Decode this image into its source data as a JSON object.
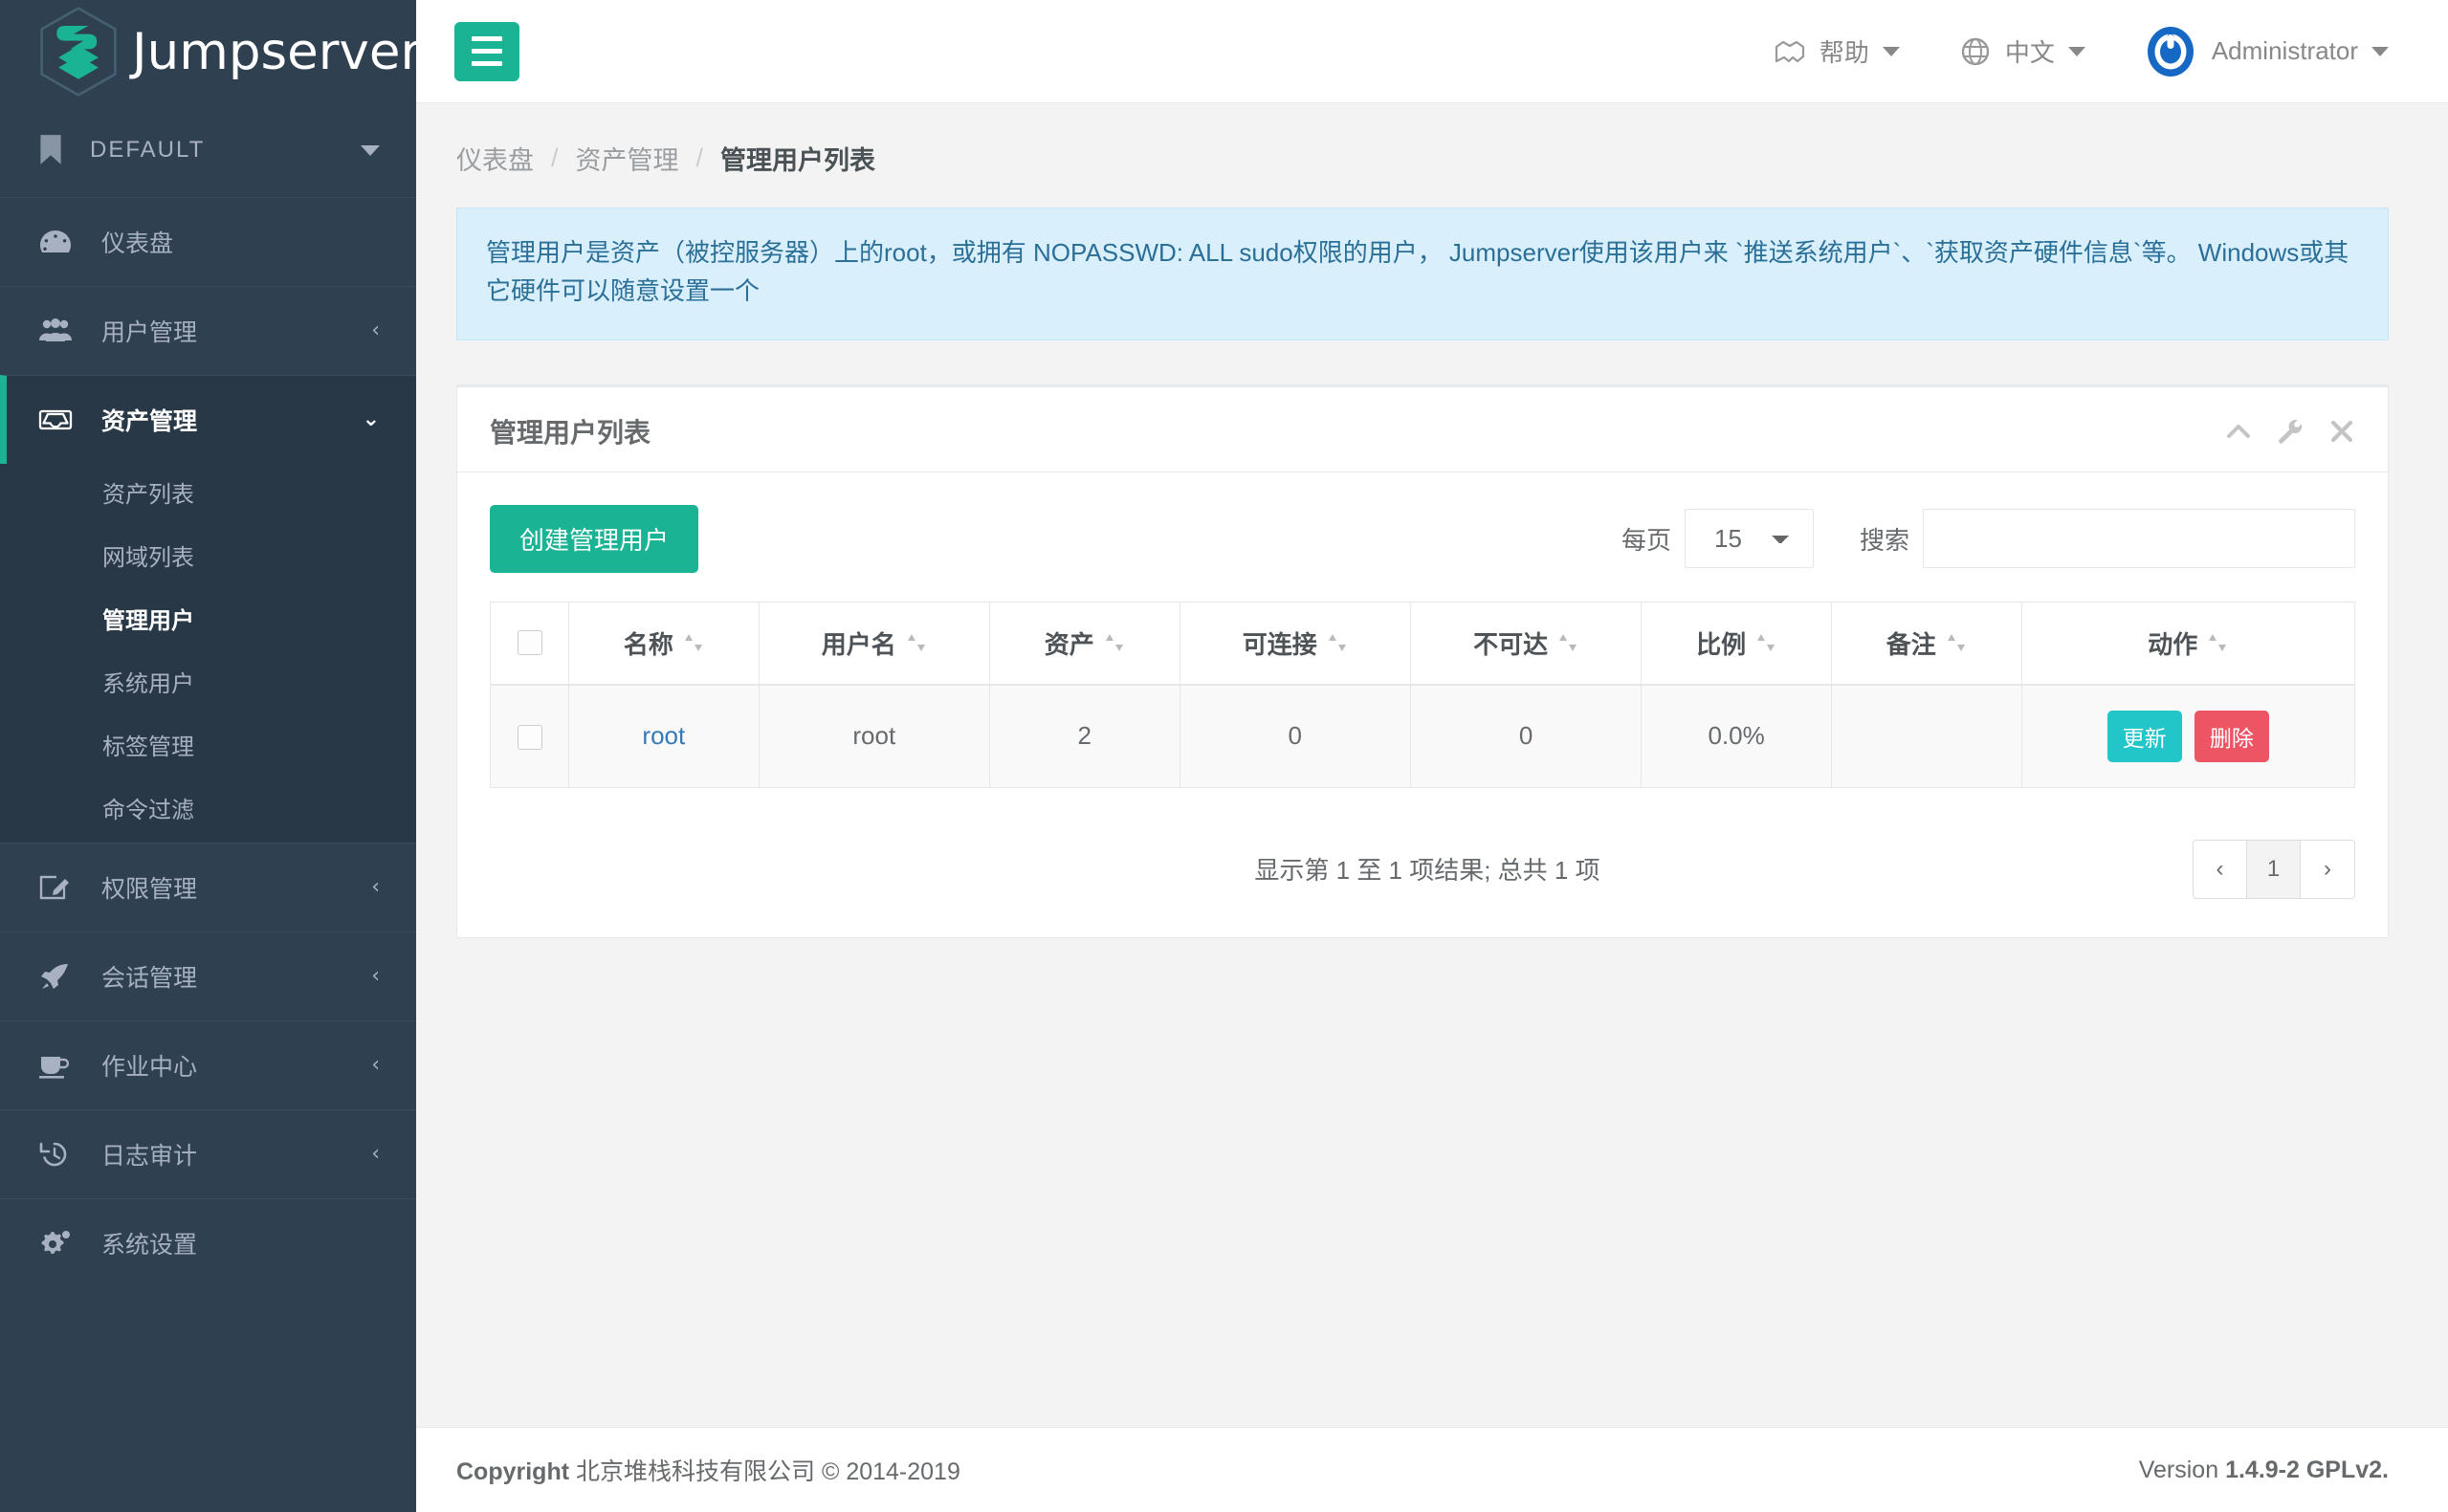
{
  "brand": {
    "name": "Jumpserver",
    "logo_color": "#1ab394",
    "org_label": "DEFAULT"
  },
  "topbar": {
    "help_label": "帮助",
    "lang_label": "中文",
    "user_label": "Administrator"
  },
  "sidebar": {
    "items": [
      {
        "label": "仪表盘",
        "icon": "dashboard-icon",
        "expandable": false,
        "active": false
      },
      {
        "label": "用户管理",
        "icon": "users-icon",
        "expandable": true,
        "active": false,
        "chevron": "‹"
      },
      {
        "label": "资产管理",
        "icon": "inbox-icon",
        "expandable": true,
        "active": true,
        "chevron": "⌄",
        "children": [
          {
            "label": "资产列表",
            "active": false
          },
          {
            "label": "网域列表",
            "active": false
          },
          {
            "label": "管理用户",
            "active": true
          },
          {
            "label": "系统用户",
            "active": false
          },
          {
            "label": "标签管理",
            "active": false
          },
          {
            "label": "命令过滤",
            "active": false
          }
        ]
      },
      {
        "label": "权限管理",
        "icon": "edit-icon",
        "expandable": true,
        "active": false,
        "chevron": "‹"
      },
      {
        "label": "会话管理",
        "icon": "rocket-icon",
        "expandable": true,
        "active": false,
        "chevron": "‹"
      },
      {
        "label": "作业中心",
        "icon": "coffee-icon",
        "expandable": true,
        "active": false,
        "chevron": "‹"
      },
      {
        "label": "日志审计",
        "icon": "history-icon",
        "expandable": true,
        "active": false,
        "chevron": "‹"
      },
      {
        "label": "系统设置",
        "icon": "gears-icon",
        "expandable": false,
        "active": false
      }
    ]
  },
  "breadcrumb": {
    "item1": "仪表盘",
    "item2": "资产管理",
    "item3": "管理用户列表",
    "separator": "/"
  },
  "alert": {
    "text": "管理用户是资产（被控服务器）上的root，或拥有 NOPASSWD: ALL sudo权限的用户， Jumpserver使用该用户来 `推送系统用户`、`获取资产硬件信息`等。 Windows或其它硬件可以随意设置一个"
  },
  "panel": {
    "title": "管理用户列表"
  },
  "toolbar": {
    "create_label": "创建管理用户",
    "length_label": "每页",
    "length_value": "15",
    "search_label": "搜索",
    "search_value": "",
    "search_placeholder": ""
  },
  "table": {
    "columns": [
      "名称",
      "用户名",
      "资产",
      "可连接",
      "不可达",
      "比例",
      "备注",
      "动作"
    ],
    "rows": [
      {
        "name": "root",
        "username": "root",
        "assets": "2",
        "reachable": "0",
        "unreachable": "0",
        "ratio": "0.0%",
        "comment": "",
        "action_update": "更新",
        "action_delete": "删除"
      }
    ]
  },
  "pagination": {
    "info": "显示第 1 至 1 项结果; 总共 1 项",
    "prev": "‹",
    "page": "1",
    "next": "›"
  },
  "footer": {
    "copyright_prefix": "Copyright",
    "copyright_text": "北京堆栈科技有限公司 © 2014-2019",
    "version_label": "Version",
    "version_value": "1.4.9-2 GPLv2."
  }
}
